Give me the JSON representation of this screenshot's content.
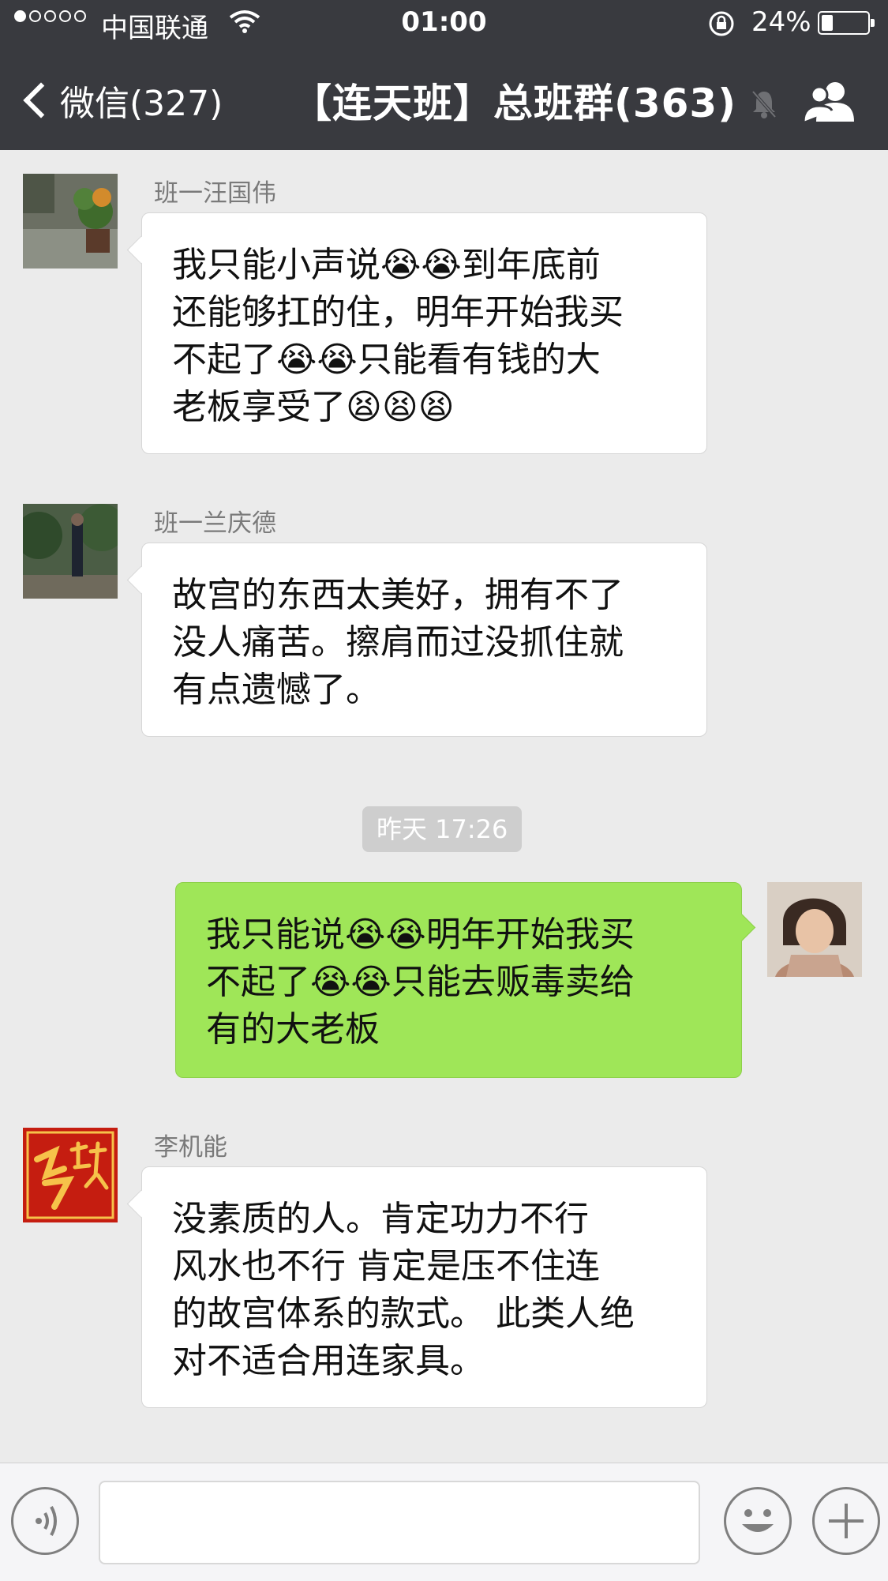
{
  "status_bar": {
    "carrier": "中国联通",
    "time": "01:00",
    "battery_percent": "24%",
    "signal_strength": 1,
    "battery_level": 0.24
  },
  "nav": {
    "back_label": "微信(327)",
    "title": "【连天班】总班群(363)",
    "muted": true
  },
  "messages": [
    {
      "sender": "班一汪国伟",
      "text_lines": [
        "我只能小声说",
        "到年底前",
        "还能够扛的住，明年开始我买",
        "不起了",
        "只能看有钱的大",
        "老板享受了"
      ]
    },
    {
      "sender": "班一兰庆德",
      "text_lines": [
        "故宫的东西太美好，拥有不了",
        "没人痛苦。擦肩而过没抓住就",
        "有点遗憾了。"
      ]
    },
    {
      "timestamp": "昨天 17:26"
    },
    {
      "self": true,
      "text_lines": [
        "我只能说",
        "明年开始我买",
        "不起了",
        "只能去贩毒卖给",
        "有的大老板"
      ]
    },
    {
      "sender": "李机能",
      "text_lines": [
        "没素质的人。肯定功力不行",
        "风水也不行  肯定是压不住连",
        "的故宫体系的款式。 此类人绝",
        "对不适合用连家具。"
      ]
    }
  ],
  "colors": {
    "nav_bg": "#393a3f",
    "chat_bg": "#ebebeb",
    "self_bubble": "#9fe658",
    "other_bubble": "#ffffff"
  },
  "icons": [
    "wifi-icon",
    "rotation-lock-icon",
    "battery-icon",
    "back-chevron-icon",
    "mute-bell-icon",
    "group-members-icon",
    "crying-emoji",
    "tired-emoji",
    "voice-icon",
    "emoji-icon",
    "plus-icon"
  ]
}
